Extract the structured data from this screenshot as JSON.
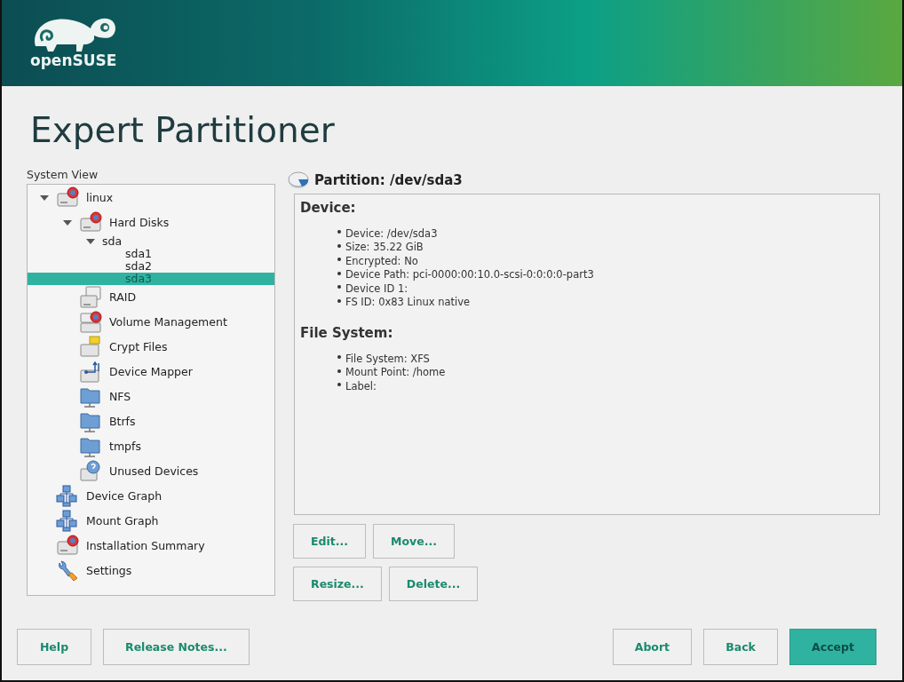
{
  "header": {
    "logo_text": "openSUSE"
  },
  "title": "Expert Partitioner",
  "system_view": {
    "label": "System View",
    "items": [
      {
        "label": "linux",
        "kind": "disk",
        "expanded": true,
        "selected": false,
        "children": [
          {
            "label": "Hard Disks",
            "kind": "disk",
            "expanded": true,
            "selected": false,
            "children": [
              {
                "label": "sda",
                "kind": "plain",
                "expanded": true,
                "selected": false,
                "children": [
                  {
                    "label": "sda1",
                    "kind": "plain",
                    "selected": false
                  },
                  {
                    "label": "sda2",
                    "kind": "plain",
                    "selected": false
                  },
                  {
                    "label": "sda3",
                    "kind": "plain",
                    "selected": true
                  }
                ]
              }
            ]
          },
          {
            "label": "RAID",
            "kind": "raid",
            "selected": false
          },
          {
            "label": "Volume Management",
            "kind": "lvm",
            "selected": false
          },
          {
            "label": "Crypt Files",
            "kind": "crypt",
            "selected": false
          },
          {
            "label": "Device Mapper",
            "kind": "mapper",
            "selected": false
          },
          {
            "label": "NFS",
            "kind": "folder",
            "selected": false
          },
          {
            "label": "Btrfs",
            "kind": "folder",
            "selected": false
          },
          {
            "label": "tmpfs",
            "kind": "folder",
            "selected": false
          },
          {
            "label": "Unused Devices",
            "kind": "unused",
            "selected": false
          }
        ]
      },
      {
        "label": "Device Graph",
        "kind": "graph",
        "selected": false
      },
      {
        "label": "Mount Graph",
        "kind": "graph",
        "selected": false
      },
      {
        "label": "Installation Summary",
        "kind": "disk",
        "selected": false
      },
      {
        "label": "Settings",
        "kind": "settings",
        "selected": false
      }
    ]
  },
  "details": {
    "heading": "Partition: /dev/sda3",
    "sections": [
      {
        "title": "Device:",
        "items": [
          "Device: /dev/sda3",
          "Size: 35.22 GiB",
          "Encrypted: No",
          "Device Path: pci-0000:00:10.0-scsi-0:0:0:0-part3",
          "Device ID 1:",
          "FS ID: 0x83 Linux native"
        ]
      },
      {
        "title": "File System:",
        "items": [
          "File System: XFS",
          "Mount Point: /home",
          "Label:"
        ]
      }
    ]
  },
  "actions": [
    [
      {
        "label": "Edit..."
      },
      {
        "label": "Move..."
      }
    ],
    [
      {
        "label": "Resize..."
      },
      {
        "label": "Delete..."
      }
    ]
  ],
  "footer": {
    "left": [
      {
        "label": "Help",
        "primary": false
      },
      {
        "label": "Release Notes...",
        "primary": false
      }
    ],
    "right": [
      {
        "label": "Abort",
        "primary": false
      },
      {
        "label": "Back",
        "primary": false
      },
      {
        "label": "Accept",
        "primary": true
      }
    ]
  }
}
